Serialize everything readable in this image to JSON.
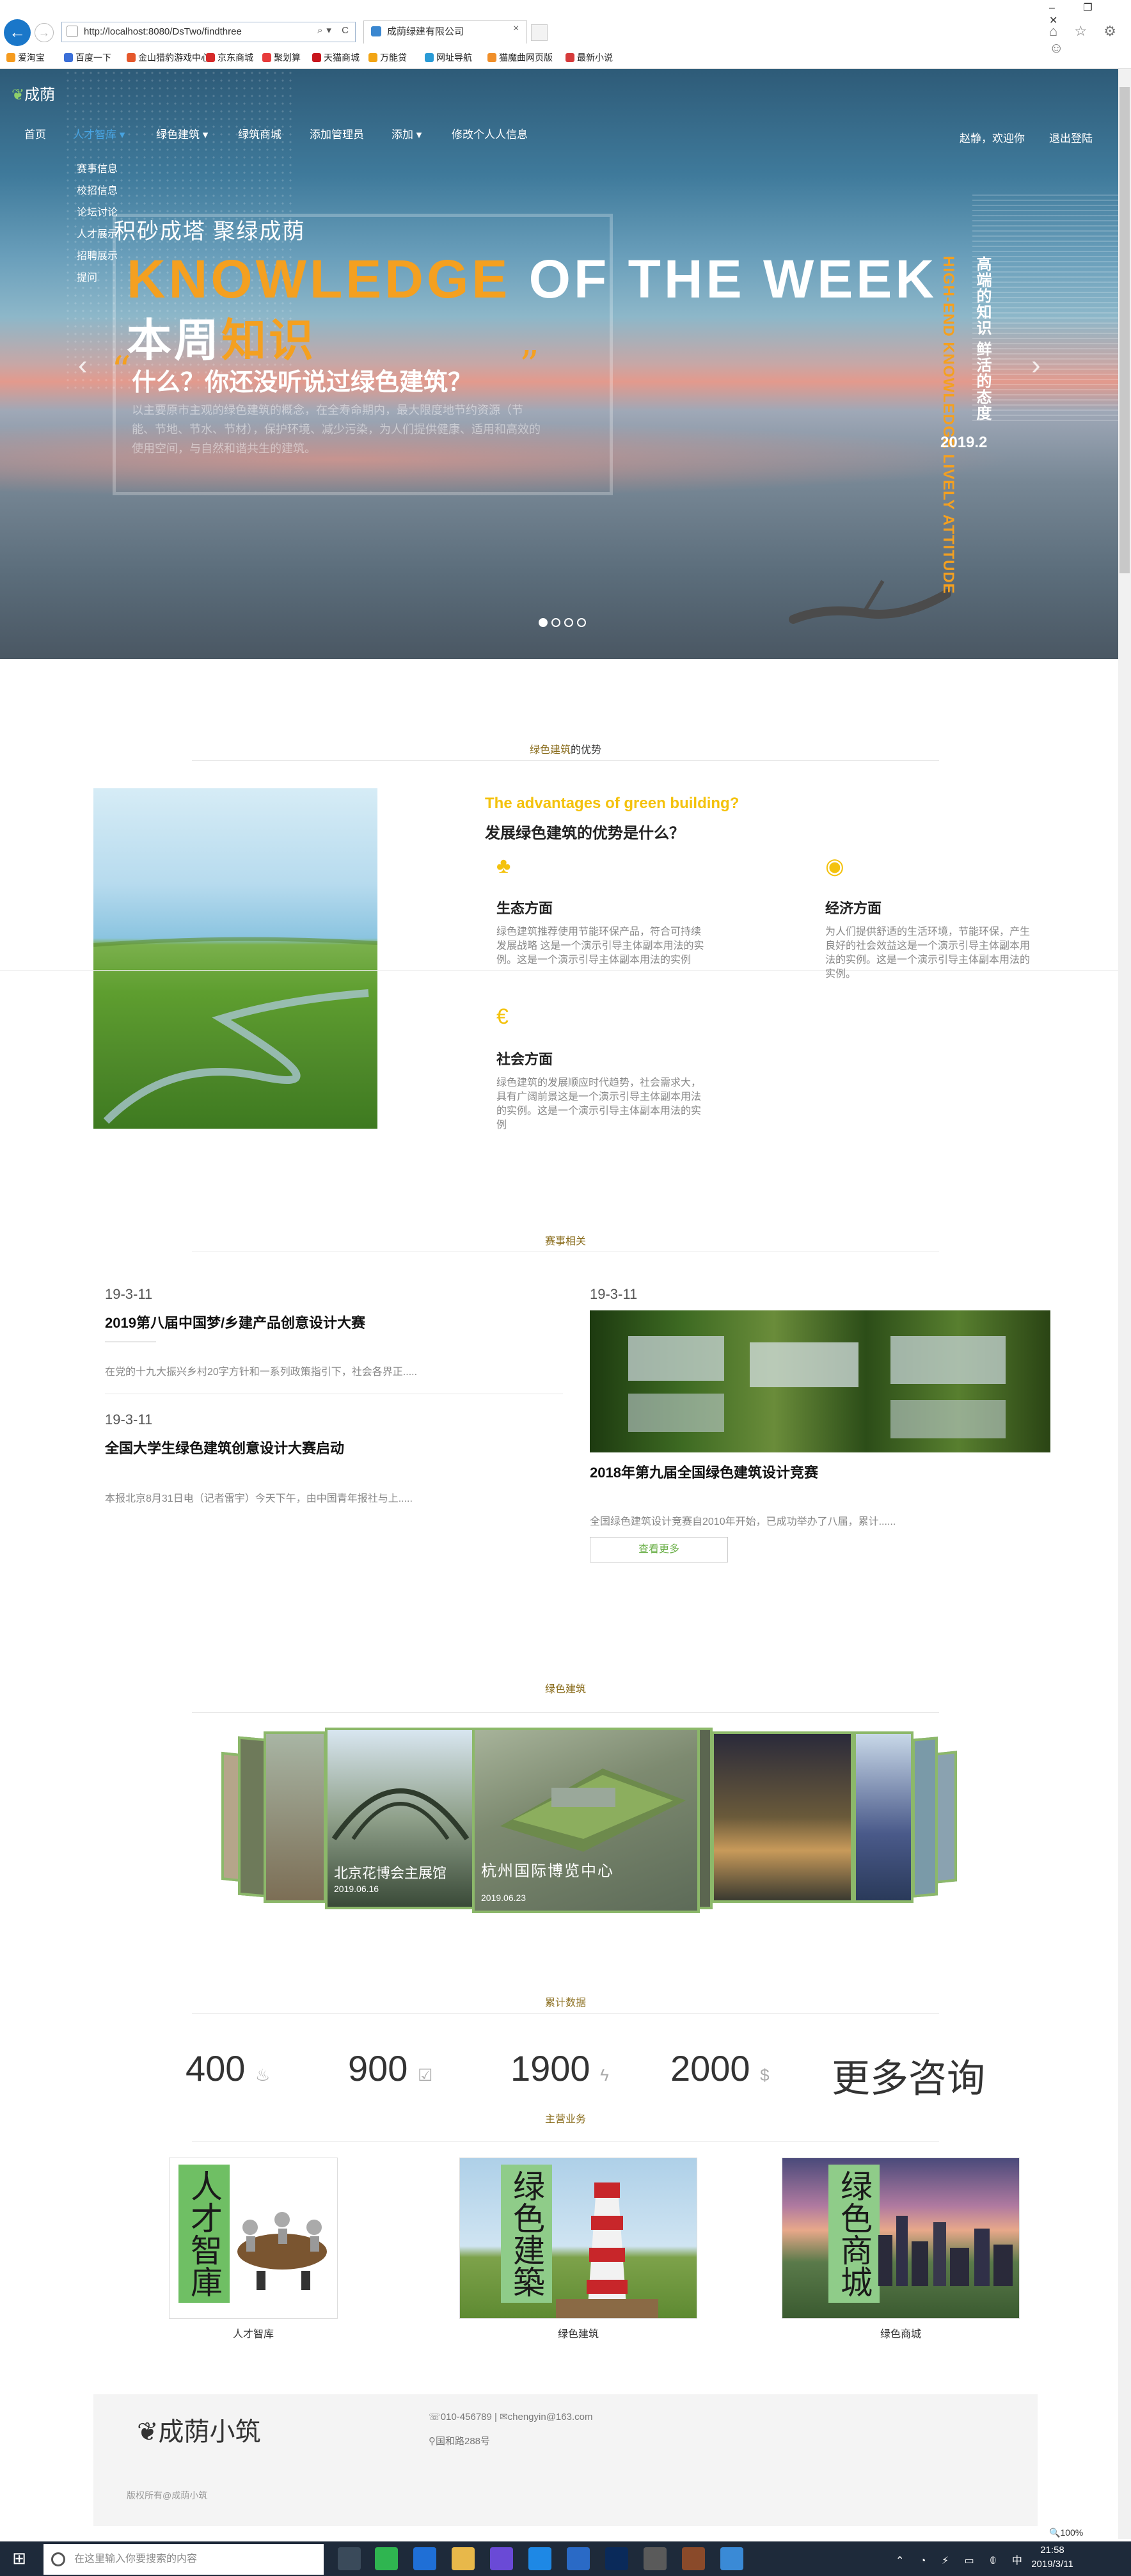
{
  "browser": {
    "url": "http://localhost:8080/DsTwo/findthree",
    "tab_title": "成荫绿建有限公司",
    "window_controls": "–  ❐  ✕",
    "addr_tools": "⌕▾ C",
    "toolbar_icons": "⌂ ☆ ⚙ ☺",
    "favorites": [
      "爱淘宝",
      "百度一下",
      "金山猎豹游戏中心",
      "京东商城",
      "聚划算",
      "天猫商城",
      "万能贷",
      "网址导航",
      "猫魔曲网页版",
      "最新小说"
    ]
  },
  "site": {
    "logo_text": "成荫",
    "nav": [
      {
        "label": "首页"
      },
      {
        "label": "人才智库 ▾"
      },
      {
        "label": "绿色建筑 ▾"
      },
      {
        "label": "绿筑商城"
      },
      {
        "label": "添加管理员"
      },
      {
        "label": "添加 ▾"
      },
      {
        "label": "修改个人人信息"
      }
    ],
    "user_greeting": "赵静，欢迎你",
    "logout": "退出登陆",
    "dropdown": [
      "赛事信息",
      "校招信息",
      "论坛讨论",
      "人才展示",
      "招聘展示",
      "提问"
    ]
  },
  "hero": {
    "slogan": "积砂成塔 聚绿成荫",
    "headline_orange": "KNOWLEDGE",
    "headline_white": "OF THE WEEK",
    "subheadline_a": "本周",
    "subheadline_b": "知识",
    "question": "什么？你还没听说过绿色建筑？",
    "description": "以主要原市主观的绿色建筑的概念，在全寿命期内，最大限度地节约资源（节能、节地、节水、节材），保护环境、减少污染，为人们提供健康、适用和高效的使用空间，与自然和谐共生的建筑。",
    "vertical_en": "HIGH-END KNOWLEDGE LIVELY ATTITUDE",
    "vertical_cn": "高端的知识 鲜活的态度",
    "date": "2019.2",
    "arrow_prev": "‹",
    "arrow_next": "›",
    "slides_total": 4,
    "slide_active": 1
  },
  "advantages": {
    "section_title_a": "绿色建筑",
    "section_title_b": "的优势",
    "heading_en": "The advantages of green building?",
    "heading_cn": "发展绿色建筑的优势是什么？",
    "items": [
      {
        "icon": "tree-icon",
        "glyph": "♣",
        "title": "生态方面",
        "text": "绿色建筑推荐使用节能环保产品，符合可持续发展战略 这是一个演示引导主体副本用法的实例。这是一个演示引导主体副本用法的实例"
      },
      {
        "icon": "eye-icon",
        "glyph": "◉",
        "title": "经济方面",
        "text": "为人们提供舒适的生活环境，节能环保，产生良好的社会效益这是一个演示引导主体副本用法的实例。这是一个演示引导主体副本用法的实例。"
      },
      {
        "icon": "euro-icon",
        "glyph": "€",
        "title": "社会方面",
        "text": "绿色建筑的发展顺应时代趋势，社会需求大，具有广阔前景这是一个演示引导主体副本用法的实例。这是一个演示引导主体副本用法的实例"
      }
    ]
  },
  "events": {
    "section_title": "赛事相关",
    "items": [
      {
        "date": "19-3-11",
        "title": "2019第八届中国梦/乡建产品创意设计大赛",
        "text": "在党的十九大振兴乡村20字方针和一系列政策指引下，社会各界正....."
      },
      {
        "date": "19-3-11",
        "title": "全国大学生绿色建筑创意设计大赛启动",
        "text": "本报北京8月31日电（记者雷宇）今天下午，由中国青年报社与上....."
      },
      {
        "date": "19-3-11",
        "title": "2018年第九届全国绿色建筑设计竞赛",
        "text": "全国绿色建筑设计竞赛自2010年开始，已成功举办了八届，累计......"
      }
    ],
    "more": "查看更多"
  },
  "gallery": {
    "section_title": "绿色建筑",
    "center_caption": "杭州国际博览中心",
    "center_date": "2019.06.23",
    "left_caption": "北京花博会主展馆",
    "left_date": "2019.06.16"
  },
  "stats": {
    "section_title": "累计数据",
    "items": [
      {
        "value": "400",
        "icon": "fire-icon",
        "glyph": "♨"
      },
      {
        "value": "900",
        "icon": "check-icon",
        "glyph": "☑"
      },
      {
        "value": "1900",
        "icon": "bolt-icon",
        "glyph": "ϟ"
      },
      {
        "value": "2000",
        "icon": "dollar-icon",
        "glyph": "$"
      }
    ],
    "more": "更多咨询"
  },
  "services": {
    "section_title": "主营业务",
    "items": [
      {
        "label": "人才智库",
        "vtext": "人才智庫"
      },
      {
        "label": "绿色建筑",
        "vtext": "绿色建築"
      },
      {
        "label": "绿色商城",
        "vtext": "绿色商城"
      }
    ]
  },
  "footer": {
    "brand": "成荫小筑",
    "phone": "010-456789",
    "email": "chengyin@163.com",
    "address": "国和路288号",
    "copyright": "版权所有@成荫小筑",
    "zoom": "100%"
  },
  "taskbar": {
    "search_placeholder": "在这里输入你要搜索的内容",
    "time": "21:58",
    "date": "2019/3/11",
    "lang": "中"
  }
}
